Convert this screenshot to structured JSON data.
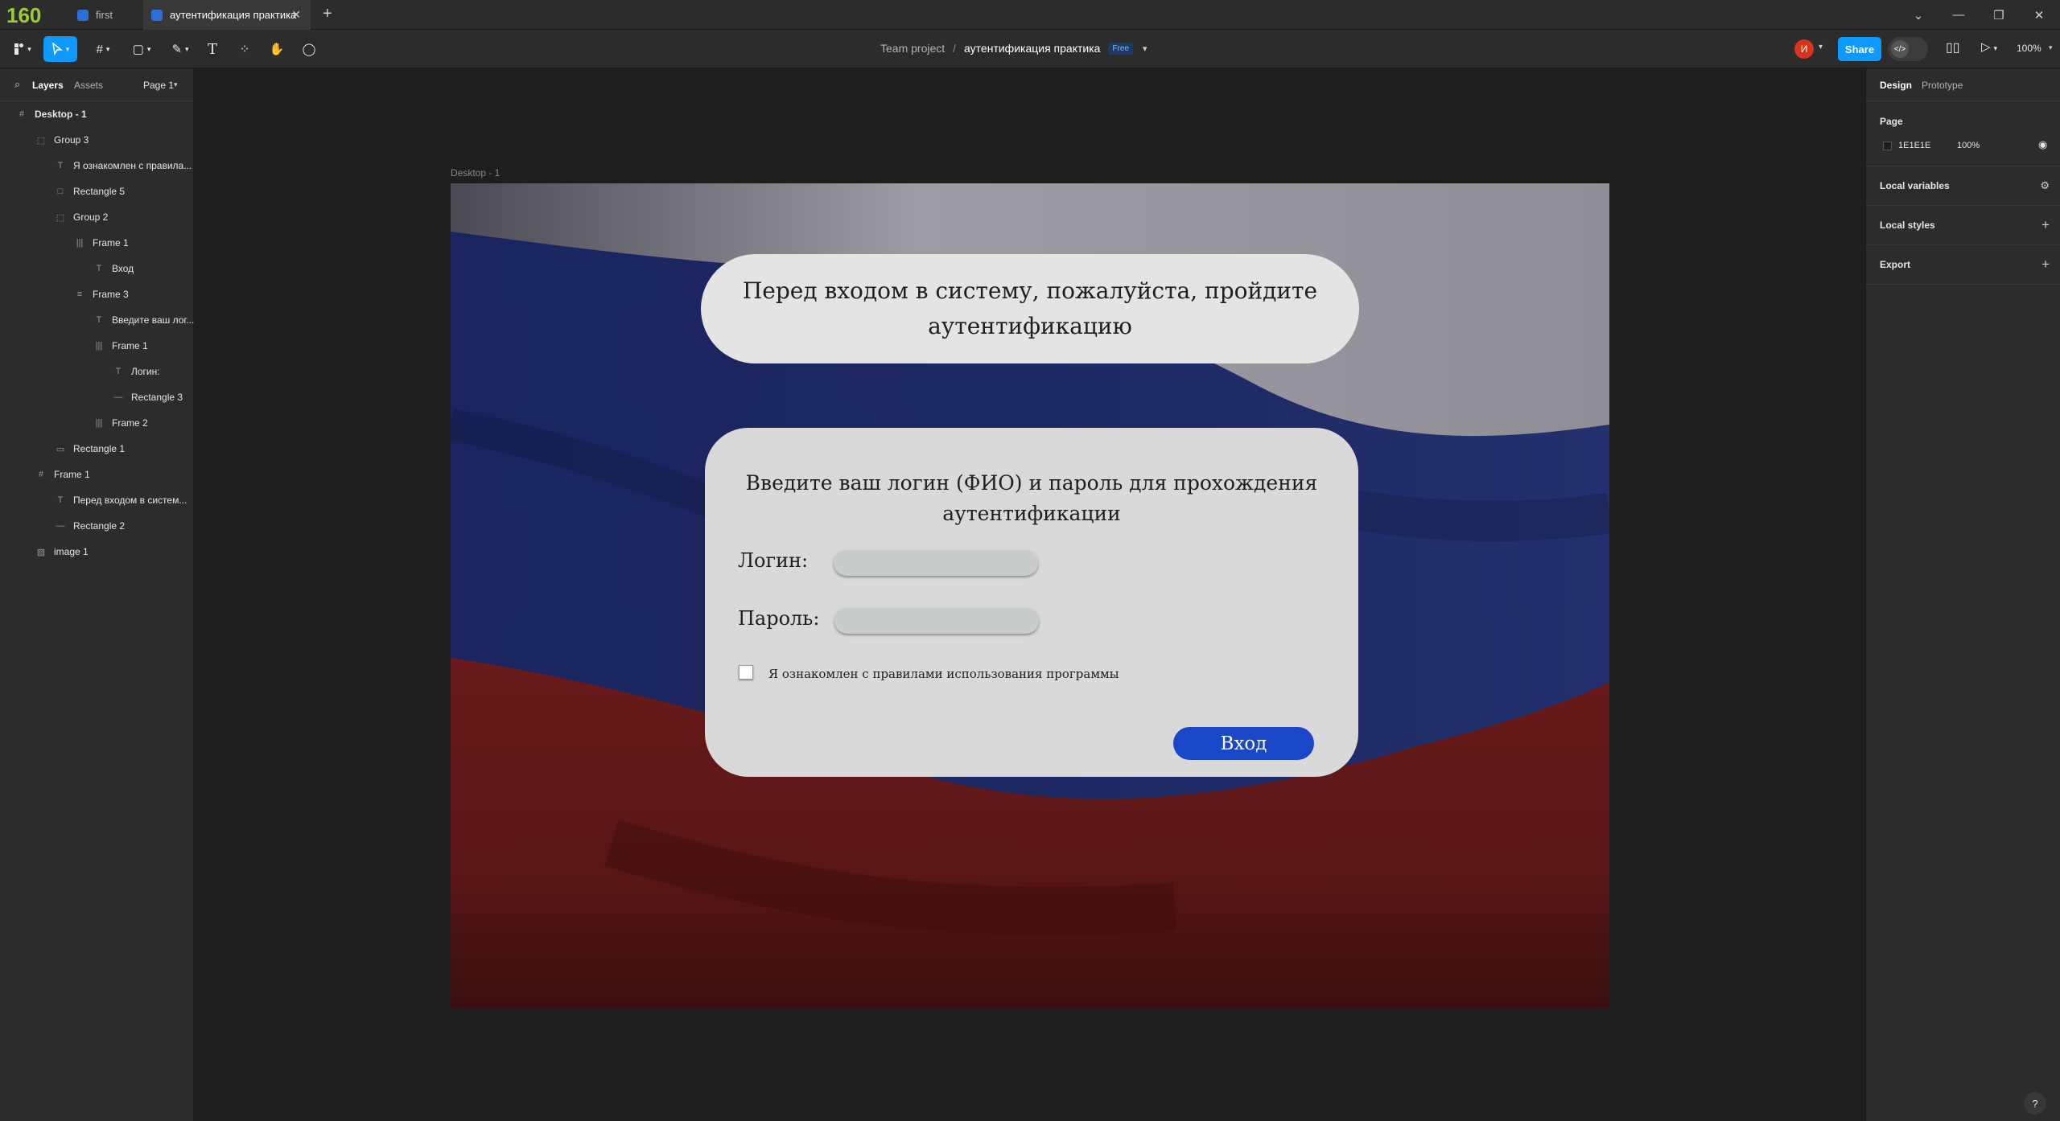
{
  "titlebar": {
    "counter": "160",
    "tabs": [
      {
        "label": "first"
      },
      {
        "label": "аутентификация практика"
      }
    ],
    "new_tab": "+"
  },
  "toolbar": {
    "breadcrumb_team": "Team project",
    "breadcrumb_sep": "/",
    "file_name": "аутентификация практика",
    "plan_badge": "Free",
    "avatar_letter": "И",
    "share_label": "Share",
    "zoom": "100%"
  },
  "left_panel": {
    "tabs": {
      "layers": "Layers",
      "assets": "Assets",
      "page": "Page 1"
    },
    "layers": [
      {
        "label": "Desktop - 1",
        "icon": "#",
        "indent": 0,
        "bold": true
      },
      {
        "label": "Group 3",
        "icon": "⬚",
        "indent": 1
      },
      {
        "label": "Я ознакомлен с правила...",
        "icon": "T",
        "indent": 2
      },
      {
        "label": "Rectangle 5",
        "icon": "□",
        "indent": 2
      },
      {
        "label": "Group 2",
        "icon": "⬚",
        "indent": 2
      },
      {
        "label": "Frame 1",
        "icon": "|||",
        "indent": 3
      },
      {
        "label": "Вход",
        "icon": "T",
        "indent": 4
      },
      {
        "label": "Frame 3",
        "icon": "≡",
        "indent": 3
      },
      {
        "label": "Введите ваш лог...",
        "icon": "T",
        "indent": 4
      },
      {
        "label": "Frame 1",
        "icon": "|||",
        "indent": 4
      },
      {
        "label": "Логин:",
        "icon": "T",
        "indent": 5
      },
      {
        "label": "Rectangle 3",
        "icon": "—",
        "indent": 5
      },
      {
        "label": "Frame 2",
        "icon": "|||",
        "indent": 4
      },
      {
        "label": "Rectangle 1",
        "icon": "▭",
        "indent": 2
      },
      {
        "label": "Frame 1",
        "icon": "#",
        "indent": 1
      },
      {
        "label": "Перед входом в систем...",
        "icon": "T",
        "indent": 2
      },
      {
        "label": "Rectangle 2",
        "icon": "—",
        "indent": 2
      },
      {
        "label": "image 1",
        "icon": "▨",
        "indent": 1
      }
    ]
  },
  "right_panel": {
    "tabs": {
      "design": "Design",
      "prototype": "Prototype"
    },
    "page_heading": "Page",
    "page_color": "1E1E1E",
    "page_opacity": "100%",
    "sections": [
      "Local variables",
      "Local styles",
      "Export"
    ]
  },
  "canvas": {
    "frame_label": "Desktop - 1",
    "banner_text": "Перед входом в систему, пожалуйста, пройдите аутентификацию",
    "card_heading": "Введите ваш логин (ФИО) и пароль для прохождения аутентификации",
    "login_label": "Логин:",
    "password_label": "Пароль:",
    "checkbox_label": "Я ознакомлен с правилами использования программы",
    "login_button": "Вход"
  },
  "help": "?",
  "colors": {
    "accent": "#0d99ff",
    "button": "#1a47c8",
    "avatar": "#d4351c"
  }
}
